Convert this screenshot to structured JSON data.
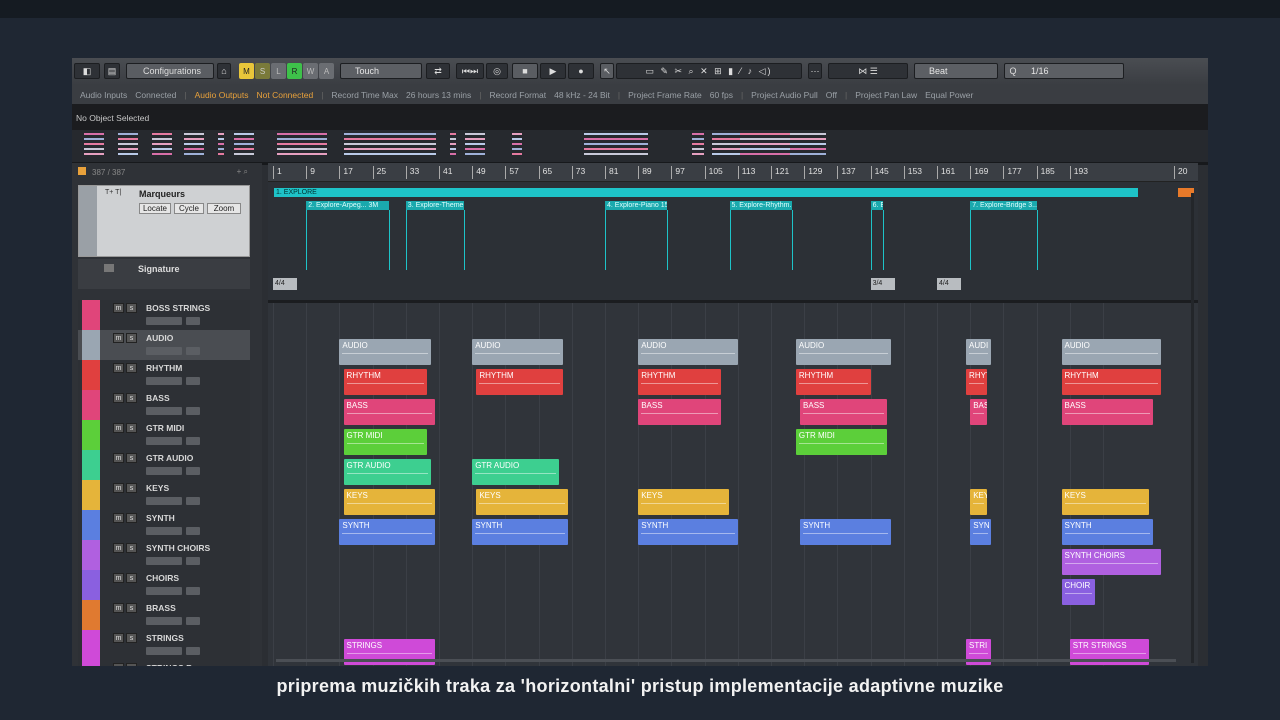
{
  "toolbar": {
    "configurations": "Configurations",
    "msb": [
      "M",
      "S",
      "L",
      "R",
      "W",
      "A"
    ],
    "automation_mode": "Touch",
    "snap_type": "Beat",
    "quantize": "1/16"
  },
  "info_line": {
    "audio_inputs_label": "Audio Inputs",
    "audio_inputs_value": "Connected",
    "audio_outputs_label": "Audio Outputs",
    "audio_outputs_value": "Not Connected",
    "record_time_label": "Record Time Max",
    "record_time_value": "26 hours 13 mins",
    "record_format_label": "Record Format",
    "record_format_value": "48 kHz - 24 Bit",
    "frame_rate_label": "Project Frame Rate",
    "frame_rate_value": "60 fps",
    "audio_pull_label": "Project Audio Pull",
    "audio_pull_value": "Off",
    "pan_law_label": "Project Pan Law",
    "pan_law_value": "Equal Power"
  },
  "selection_bar": "No Object Selected",
  "tracklist": {
    "count": "387 / 387",
    "marker_track": "Marqueurs",
    "marker_buttons": [
      "Locate",
      "Cycle",
      "Zoom"
    ],
    "signature_track": "Signature",
    "tracks": [
      {
        "name": "BOSS STRINGS",
        "color": "#e0457a"
      },
      {
        "name": "AUDIO",
        "color": "#9aa6b2"
      },
      {
        "name": "RHYTHM",
        "color": "#e0403f"
      },
      {
        "name": "BASS",
        "color": "#e0457a"
      },
      {
        "name": "GTR MIDI",
        "color": "#5ccf3a"
      },
      {
        "name": "GTR AUDIO",
        "color": "#3dcf90"
      },
      {
        "name": "KEYS",
        "color": "#e5b43a"
      },
      {
        "name": "SYNTH",
        "color": "#5b7fe0"
      },
      {
        "name": "SYNTH CHOIRS",
        "color": "#b060e0"
      },
      {
        "name": "CHOIRS",
        "color": "#8a60e0"
      },
      {
        "name": "BRASS",
        "color": "#e07a30"
      },
      {
        "name": "STRINGS",
        "color": "#cf4ad8"
      },
      {
        "name": "STRINGS B",
        "color": "#cf4ad8"
      }
    ]
  },
  "ruler": [
    "1",
    "9",
    "17",
    "25",
    "33",
    "41",
    "49",
    "57",
    "65",
    "73",
    "81",
    "89",
    "97",
    "105",
    "113",
    "121",
    "129",
    "137",
    "145",
    "153",
    "161",
    "169",
    "177",
    "185",
    "193",
    "20"
  ],
  "markers": {
    "cycle": "1. EXPLORE",
    "items": [
      "2. Explore-Arpeg...  3M",
      "3. Explore-Theme...  3M",
      "4. Explore-Piano 15...  P0",
      "5. Explore-Rhythm...  3M",
      "6. Exp",
      "7. Explore-Bridge 3...  P0"
    ]
  },
  "signatures": [
    "4/4",
    "3/4",
    "4/4"
  ],
  "parts": {
    "audio": "AUDIO",
    "rhythm": "RHYTHM",
    "bass": "BASS",
    "gtr_midi": "GTR MIDI",
    "gtr_audio": "GTR AUDIO",
    "keys": "KEYS",
    "synth": "SYNTH",
    "synth_choirs": "SYNTH CHOIRS",
    "choir": "CHOIR",
    "strings": "STRINGS",
    "str_strings": "STR STRINGS",
    "audi_short": "AUDI",
    "rhyt_short": "RHYT",
    "bas_short": "BAS",
    "key_short": "KEY",
    "syn_short": "SYN",
    "stri_short": "STRI"
  },
  "caption": "priprema muzičkih traka za 'horizontalni' pristup implementacije adaptivne muzike"
}
